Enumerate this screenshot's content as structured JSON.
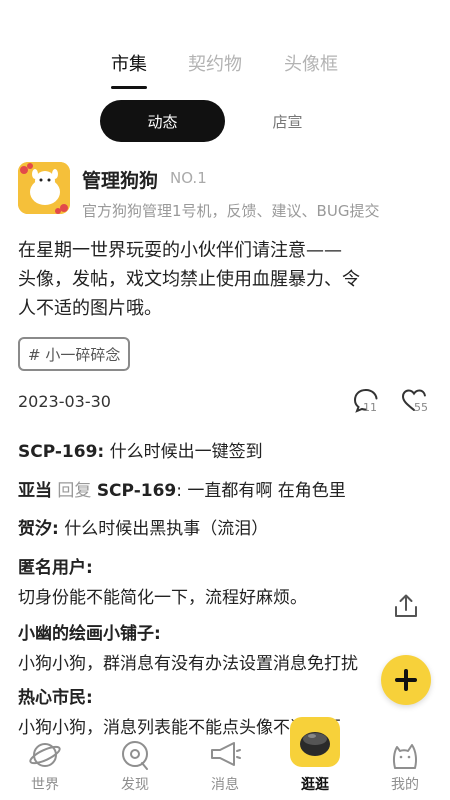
{
  "top_tabs": [
    {
      "label": "市集",
      "active": true
    },
    {
      "label": "契约物",
      "active": false
    },
    {
      "label": "头像框",
      "active": false
    }
  ],
  "sub_tabs": [
    {
      "label": "动态",
      "active": true
    },
    {
      "label": "店宣",
      "active": false
    }
  ],
  "post": {
    "author": "管理狗狗",
    "rank": "NO.1",
    "bio": "官方狗狗管理1号机，反馈、建议、BUG提交",
    "content_lines": [
      "在星期一世界玩耍的小伙伴们请注意——",
      "头像，发帖，戏文均禁止使用血腥暴力、令",
      "人不适的图片哦。"
    ],
    "tag": "# 小一碎碎念",
    "date": "2023-03-30",
    "comment_count": "11",
    "like_count": "55"
  },
  "comments": [
    {
      "user": "SCP-169:",
      "text": "什么时候出一键签到"
    },
    {
      "user": "亚当",
      "reply_word": "回复",
      "reply_to": "SCP-169",
      "text": ": 一直都有啊 在角色里"
    },
    {
      "user": "贺汐:",
      "text": "什么时候出黑执事（流泪）"
    },
    {
      "user": "匿名用户:",
      "text": "切身份能不能简化一下，流程好麻烦。"
    },
    {
      "user": "小幽的绘画小铺子:",
      "text": "小狗小狗，群消息有没有办法设置消息免打扰"
    },
    {
      "user": "热心市民:",
      "text": "小狗小狗，消息列表能不能点头像不进主页"
    }
  ],
  "nav": [
    {
      "label": "世界",
      "icon": "planet-icon"
    },
    {
      "label": "发现",
      "icon": "discover-icon"
    },
    {
      "label": "消息",
      "icon": "megaphone-icon"
    },
    {
      "label": "逛逛",
      "icon": "stroll-icon"
    },
    {
      "label": "我的",
      "icon": "cat-icon"
    }
  ],
  "colors": {
    "accent": "#f7d13a",
    "text": "#1a1a1a",
    "muted": "#999999"
  }
}
